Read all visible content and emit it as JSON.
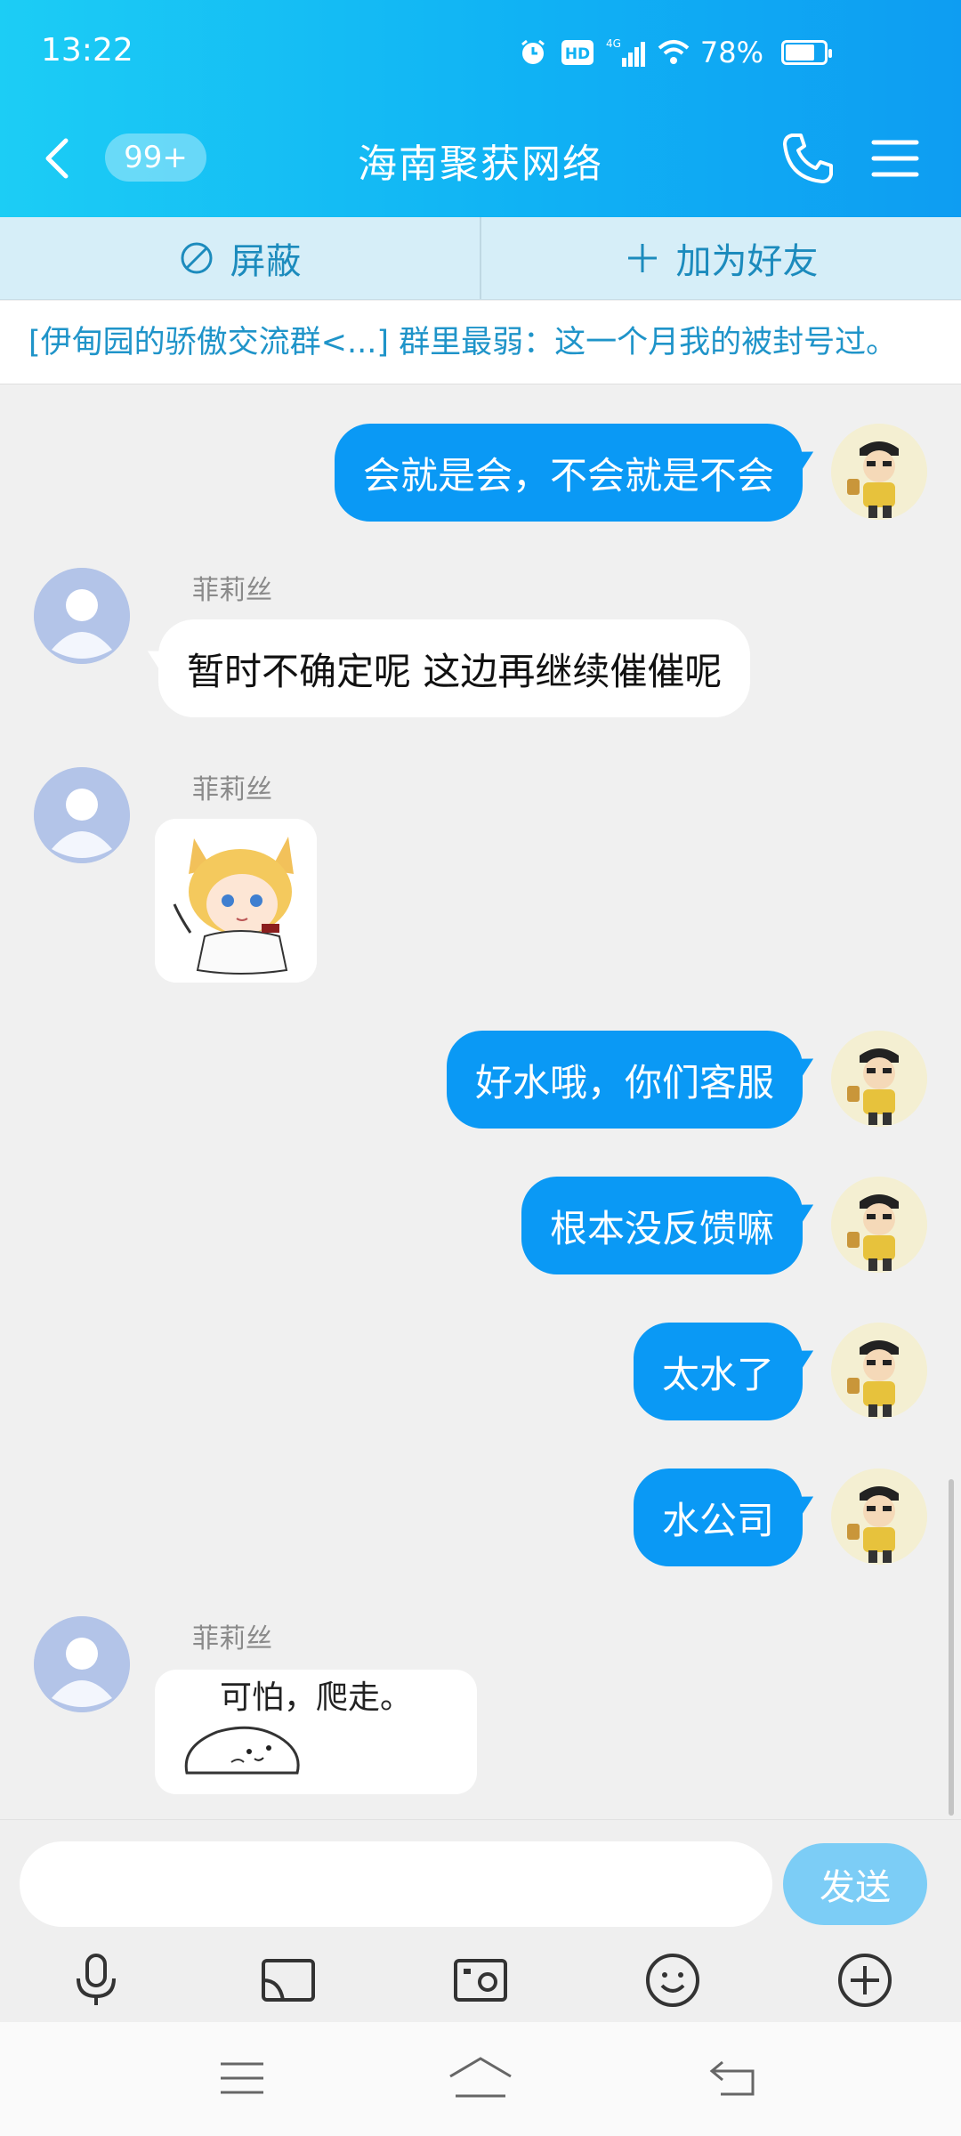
{
  "status": {
    "time": "13:22",
    "network": "4G",
    "hd": "HD",
    "battery_text": "78%",
    "battery_level": 0.78
  },
  "header": {
    "unread_badge": "99+",
    "title": "海南聚获网络"
  },
  "actions": {
    "block_label": "屏蔽",
    "add_friend_label": "加为好友"
  },
  "notice": {
    "text": "[伊甸园的骄傲交流群<...] 群里最弱：这一个月我的被封号过。"
  },
  "messages": [
    {
      "from": "self",
      "text": "会就是会，不会就是不会"
    },
    {
      "from": "other",
      "sender": "菲莉丝",
      "text": "暂时不确定呢 这边再继续催催呢"
    },
    {
      "from": "other",
      "sender": "菲莉丝",
      "sticker": "fox-girl-sticker"
    },
    {
      "from": "self",
      "text": "好水哦，你们客服"
    },
    {
      "from": "self",
      "text": "根本没反馈嘛"
    },
    {
      "from": "self",
      "text": "太水了"
    },
    {
      "from": "self",
      "text": "水公司"
    },
    {
      "from": "other",
      "sender": "菲莉丝",
      "sticker": "seal-sticker",
      "sticker_caption": "可怕，爬走。"
    }
  ],
  "input": {
    "placeholder": "",
    "send_label": "发送"
  },
  "toolbar": {
    "icons": [
      "microphone-icon",
      "screen-cast-icon",
      "photo-icon",
      "emoji-icon",
      "plus-icon"
    ]
  },
  "colors": {
    "header": "#10b2f4",
    "outgoing_bubble": "#0a99f5",
    "send_button": "#7ccdf6",
    "action_text": "#1c8bbd"
  }
}
